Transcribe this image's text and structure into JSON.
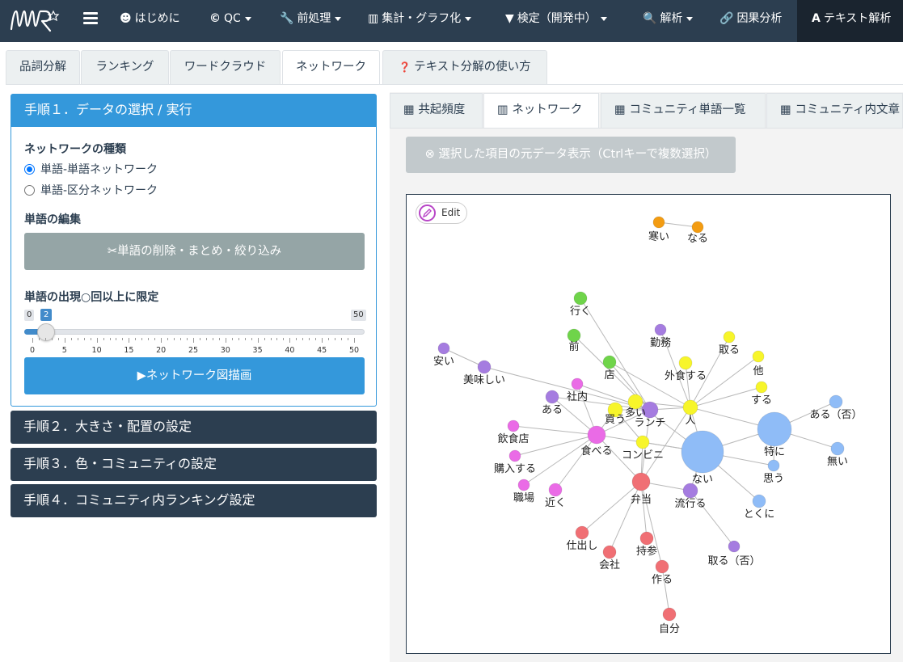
{
  "app": {
    "logo_text": "NMR",
    "nav": [
      {
        "icon": "smile-icon",
        "glyph": "☻",
        "label": "はじめに",
        "dropdown": false
      },
      {
        "icon": "copyright-icon",
        "glyph": "©",
        "label": "QC",
        "dropdown": true
      },
      {
        "icon": "wrench-icon",
        "glyph": "🔧",
        "label": "前処理",
        "dropdown": true
      },
      {
        "icon": "bar-chart-icon",
        "glyph": "▥",
        "label": "集計・グラフ化",
        "dropdown": true
      },
      {
        "icon": "filter-icon",
        "glyph": "▼",
        "label": "検定（開発中）",
        "dropdown": true
      },
      {
        "icon": "search-icon",
        "glyph": "🔍",
        "label": "解析",
        "dropdown": true
      },
      {
        "icon": "link-icon",
        "glyph": "🔗",
        "label": "因果分析",
        "dropdown": false
      },
      {
        "icon": "font-icon",
        "glyph": "A",
        "label": "テキスト解析",
        "dropdown": false
      }
    ]
  },
  "top_tabs": [
    {
      "label": "品詞分解",
      "active": false
    },
    {
      "label": "ランキング",
      "active": false
    },
    {
      "label": "ワードクラウド",
      "active": false
    },
    {
      "label": "ネットワーク",
      "active": true
    },
    {
      "label": "テキスト分解の使い方",
      "icon": "question-circle-icon",
      "active": false
    }
  ],
  "sidebar": {
    "step1": {
      "title": "手順１．データの選択 / 実行",
      "network_type_title": "ネットワークの種類",
      "radio_options": [
        {
          "label": "単語-単語ネットワーク",
          "checked": true
        },
        {
          "label": "単語-区分ネットワーク",
          "checked": false
        }
      ],
      "edit_title": "単語の編集",
      "edit_button": "単語の削除・まとめ・絞り込み",
      "limit_title": "単語の出現○回以上に限定",
      "slider": {
        "min": 0,
        "max": 50,
        "value": 2,
        "ticks": [
          "0",
          "5",
          "10",
          "15",
          "20",
          "25",
          "30",
          "35",
          "40",
          "45",
          "50"
        ]
      },
      "draw_button": "ネットワーク図描画"
    },
    "step2": "手順２．大きさ・配置の設定",
    "step3": "手順３．色・コミュニティの設定",
    "step4": "手順４．コミュニティ内ランキング設定"
  },
  "sub_tabs": [
    {
      "label": "共起頻度",
      "icon": "table-icon",
      "active": false
    },
    {
      "label": "ネットワーク",
      "icon": "chart-icon",
      "active": true
    },
    {
      "label": "コミュニティ単語一覧",
      "icon": "table-icon",
      "active": false
    },
    {
      "label": "コミュニティ内文章",
      "icon": "table-icon",
      "active": false
    }
  ],
  "source_button": "選択した項目の元データ表示（Ctrlキーで複数選択）",
  "edit_label": "Edit",
  "network": {
    "colors": {
      "orange": "#f39c12",
      "green": "#6fd44a",
      "purple": "#a57ce0",
      "yellow": "#f7f52a",
      "pink": "#ea6be6",
      "blue": "#8fbcf7",
      "red": "#f06f74",
      "edge": "#b8b8b8"
    },
    "nodes": [
      {
        "id": "寒い",
        "c": "orange"
      },
      {
        "id": "なる",
        "c": "orange"
      },
      {
        "id": "行く",
        "c": "green"
      },
      {
        "id": "前",
        "c": "green"
      },
      {
        "id": "店",
        "c": "green"
      },
      {
        "id": "勤務",
        "c": "purple"
      },
      {
        "id": "安い",
        "c": "purple"
      },
      {
        "id": "美味しい",
        "c": "purple"
      },
      {
        "id": "ある",
        "c": "purple"
      },
      {
        "id": "ランチ",
        "c": "purple"
      },
      {
        "id": "流行る",
        "c": "purple"
      },
      {
        "id": "取る（否）",
        "c": "purple"
      },
      {
        "id": "取る",
        "c": "yellow"
      },
      {
        "id": "他",
        "c": "yellow"
      },
      {
        "id": "する",
        "c": "yellow"
      },
      {
        "id": "外食する",
        "c": "yellow"
      },
      {
        "id": "人",
        "c": "yellow"
      },
      {
        "id": "多い",
        "c": "yellow"
      },
      {
        "id": "買う",
        "c": "yellow"
      },
      {
        "id": "コンビニ",
        "c": "yellow"
      },
      {
        "id": "社内",
        "c": "pink"
      },
      {
        "id": "飲食店",
        "c": "pink"
      },
      {
        "id": "購入する",
        "c": "pink"
      },
      {
        "id": "職場",
        "c": "pink"
      },
      {
        "id": "近く",
        "c": "pink"
      },
      {
        "id": "食べる",
        "c": "pink"
      },
      {
        "id": "ない",
        "c": "blue"
      },
      {
        "id": "特に",
        "c": "blue"
      },
      {
        "id": "思う",
        "c": "blue"
      },
      {
        "id": "ある（否）",
        "c": "blue"
      },
      {
        "id": "無い",
        "c": "blue"
      },
      {
        "id": "とくに",
        "c": "blue"
      },
      {
        "id": "弁当",
        "c": "red"
      },
      {
        "id": "仕出し",
        "c": "red"
      },
      {
        "id": "会社",
        "c": "red"
      },
      {
        "id": "持参",
        "c": "red"
      },
      {
        "id": "作る",
        "c": "red"
      },
      {
        "id": "自分",
        "c": "red"
      }
    ],
    "edges": [
      [
        "寒い",
        "なる"
      ],
      [
        "行く",
        "ランチ"
      ],
      [
        "前",
        "ランチ"
      ],
      [
        "店",
        "ランチ"
      ],
      [
        "店",
        "人"
      ],
      [
        "勤務",
        "人"
      ],
      [
        "安い",
        "美味しい"
      ],
      [
        "美味しい",
        "ランチ"
      ],
      [
        "ある",
        "ランチ"
      ],
      [
        "ある",
        "食べる"
      ],
      [
        "取る",
        "人"
      ],
      [
        "他",
        "人"
      ],
      [
        "する",
        "人"
      ],
      [
        "外食する",
        "人"
      ],
      [
        "多い",
        "人"
      ],
      [
        "人",
        "ランチ"
      ],
      [
        "人",
        "ない"
      ],
      [
        "人",
        "特に"
      ],
      [
        "人",
        "弁当"
      ],
      [
        "買う",
        "ランチ"
      ],
      [
        "買う",
        "食べる"
      ],
      [
        "買う",
        "コンビニ"
      ],
      [
        "社内",
        "食べる"
      ],
      [
        "社内",
        "ランチ"
      ],
      [
        "飲食店",
        "食べる"
      ],
      [
        "購入する",
        "食べる"
      ],
      [
        "職場",
        "食べる"
      ],
      [
        "近く",
        "食べる"
      ],
      [
        "食べる",
        "弁当"
      ],
      [
        "食べる",
        "ない"
      ],
      [
        "食べる",
        "ランチ"
      ],
      [
        "コンビニ",
        "弁当"
      ],
      [
        "コンビニ",
        "ない"
      ],
      [
        "ない",
        "特に"
      ],
      [
        "ない",
        "思う"
      ],
      [
        "ない",
        "とくに"
      ],
      [
        "ない",
        "流行る"
      ],
      [
        "特に",
        "ある（否）"
      ],
      [
        "特に",
        "無い"
      ],
      [
        "特に",
        "思う"
      ],
      [
        "流行る",
        "取る（否）"
      ],
      [
        "弁当",
        "仕出し"
      ],
      [
        "弁当",
        "会社"
      ],
      [
        "弁当",
        "持参"
      ],
      [
        "弁当",
        "作る"
      ],
      [
        "作る",
        "自分"
      ],
      [
        "弁当",
        "流行る"
      ],
      [
        "ランチ",
        "弁当"
      ],
      [
        "多い",
        "ない"
      ]
    ]
  }
}
